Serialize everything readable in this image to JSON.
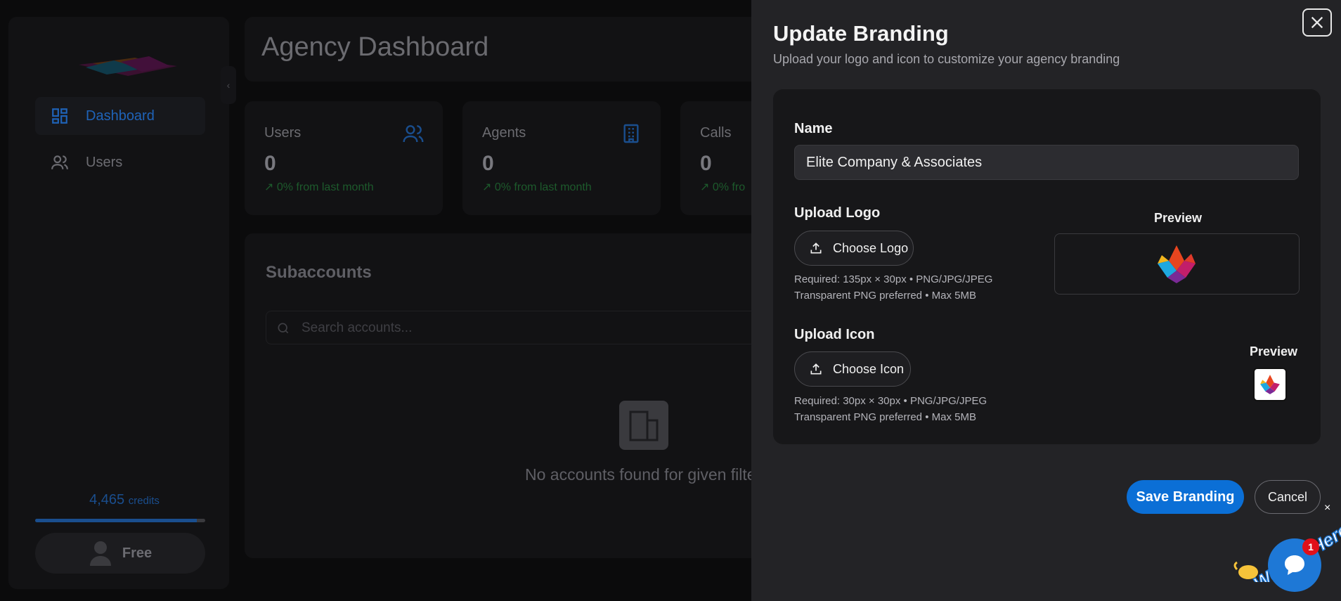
{
  "sidebar": {
    "items": [
      {
        "label": "Dashboard",
        "icon": "dashboard-grid-icon",
        "active": true
      },
      {
        "label": "Users",
        "icon": "users-icon",
        "active": false
      }
    ],
    "credits_value": "4,465",
    "credits_unit": "credits",
    "credits_fill_fraction": 0.95,
    "plan_label": "Free"
  },
  "header": {
    "title": "Agency Dashboard"
  },
  "stats": [
    {
      "label": "Users",
      "value": "0",
      "change": "0% from last month",
      "icon": "users-icon"
    },
    {
      "label": "Agents",
      "value": "0",
      "change": "0% from last month",
      "icon": "building-icon"
    },
    {
      "label": "Calls",
      "value": "0",
      "change": "0% fro",
      "icon": "phone-icon"
    }
  ],
  "subaccounts": {
    "title": "Subaccounts",
    "search_placeholder": "Search accounts...",
    "empty_text": "No accounts found for given filter"
  },
  "drawer": {
    "title": "Update Branding",
    "subtitle": "Upload your logo and icon to customize your agency branding",
    "name_label": "Name",
    "name_value": "Elite Company & Associates",
    "logo_label": "Upload Logo",
    "logo_button": "Choose Logo",
    "logo_hint_1": "Required: 135px × 30px • PNG/JPG/JPEG",
    "logo_hint_2": "Transparent PNG preferred • Max 5MB",
    "logo_preview_label": "Preview",
    "icon_label": "Upload Icon",
    "icon_button": "Choose Icon",
    "icon_hint_1": "Required: 30px × 30px • PNG/JPG/JPEG",
    "icon_hint_2": "Transparent PNG preferred • Max 5MB",
    "icon_preview_label": "Preview",
    "save_button": "Save Branding",
    "cancel_button": "Cancel"
  },
  "chat": {
    "banner_text": "We Are Here!",
    "badge_count": "1",
    "close_glyph": "×"
  },
  "colors": {
    "accent": "#0b6fd6",
    "drawer_bg": "#232326",
    "card_bg": "#171719",
    "badge": "#e0101a"
  }
}
